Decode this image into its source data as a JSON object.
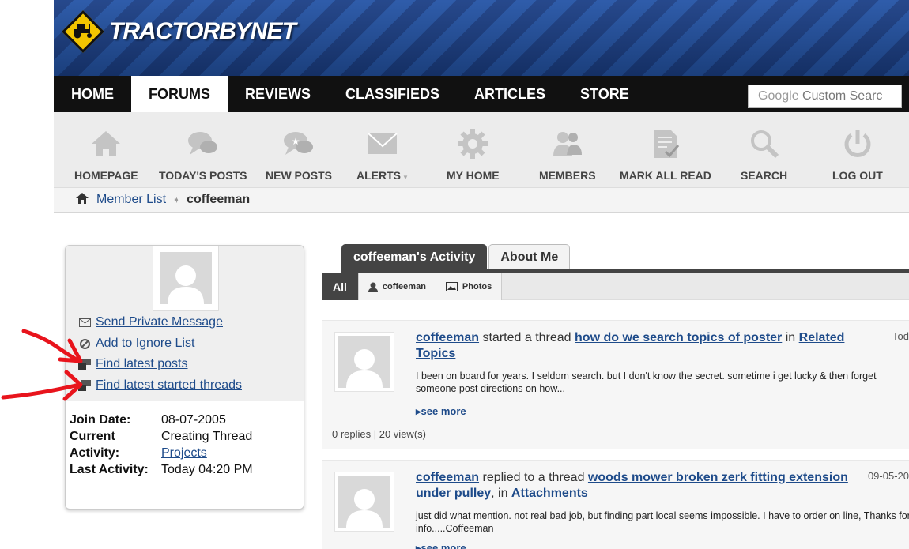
{
  "logo": {
    "text": "TRACTORBYNET"
  },
  "main_nav": {
    "home": "HOME",
    "forums": "FORUMS",
    "reviews": "REVIEWS",
    "classifieds": "CLASSIFIEDS",
    "articles": "ARTICLES",
    "store": "STORE"
  },
  "search": {
    "brand": "Google",
    "placeholder": "Custom Searc"
  },
  "sub_nav": {
    "homepage": "HOMEPAGE",
    "todays_posts": "TODAY'S POSTS",
    "new_posts": "NEW POSTS",
    "alerts": "ALERTS",
    "my_home": "MY HOME",
    "members": "MEMBERS",
    "mark_all_read": "MARK ALL READ",
    "search": "SEARCH",
    "log_out": "LOG OUT"
  },
  "breadcrumb": {
    "parent": "Member List",
    "current": "coffeeman"
  },
  "profile": {
    "send_pm": "Send Private Message",
    "ignore": "Add to Ignore List",
    "latest_posts": "Find latest posts",
    "latest_threads": "Find latest started threads",
    "join_date_label": "Join Date:",
    "join_date": "08-07-2005",
    "current_activity_label": "Current Activity:",
    "current_activity": "Creating Thread",
    "current_activity_link": "Projects",
    "last_activity_label": "Last Activity:",
    "last_activity": "Today 04:20 PM"
  },
  "tabs": {
    "activity": "coffeeman's Activity",
    "about": "About Me"
  },
  "filters": {
    "all": "All",
    "user": "coffeeman",
    "photos": "Photos"
  },
  "activity": [
    {
      "user": "coffeeman",
      "action": "started a thread",
      "thread": "how do we search topics of poster",
      "in": "in",
      "forum": "Related Topics",
      "date": "Tod",
      "body": "I been on board for years. I seldom search. but I don't know the secret. sometime i get lucky & then forget someone post directions on how...",
      "see_more": "see more",
      "meta": "0 replies | 20 view(s)"
    },
    {
      "user": "coffeeman",
      "action": "replied to a thread",
      "thread": "woods mower broken zerk fitting extension under pulley",
      "in": ", in",
      "forum": "Attachments",
      "date": "09-05-20",
      "body": "just did what mention. not real bad job, but finding part local seems impossible. I have to order on line, Thanks for info.....Coffeeman",
      "see_more": "see more"
    }
  ],
  "colors": {
    "link": "#1e4b8a",
    "nav_bg": "#111111",
    "annotation": "#e8141c"
  }
}
